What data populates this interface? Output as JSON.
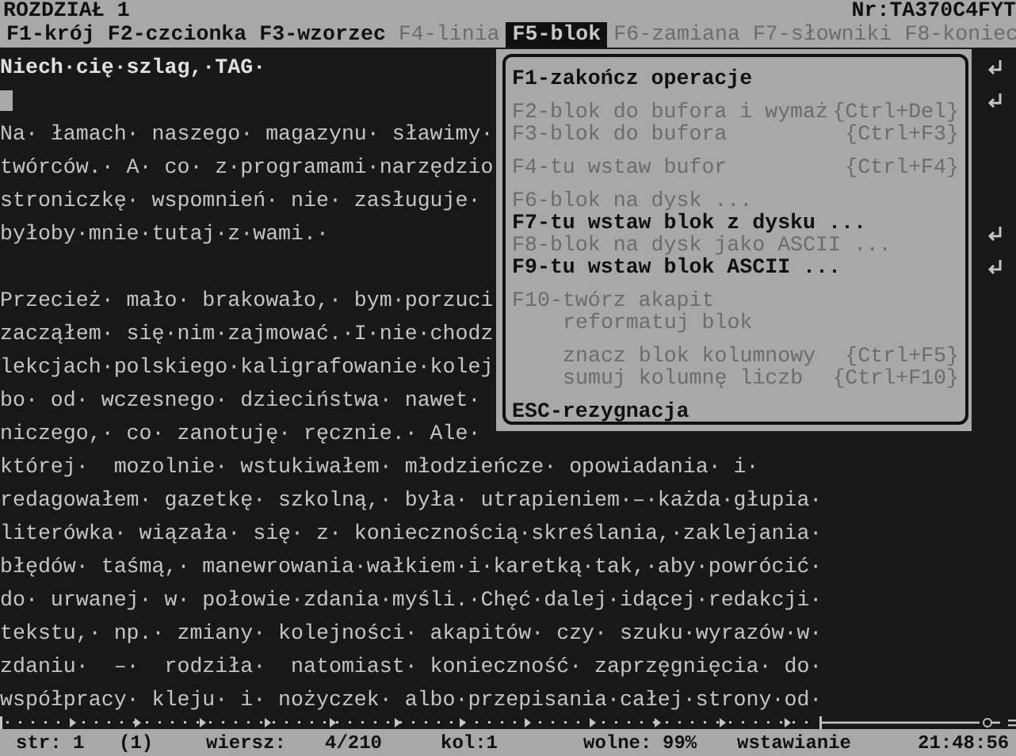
{
  "title_bar": {
    "chapter": "ROZDZIAŁ 1",
    "number": "Nr:TA370C4FYT"
  },
  "menu": [
    {
      "label": "F1-krój",
      "selected": false,
      "disabled": false
    },
    {
      "label": "F2-czcionka",
      "selected": false,
      "disabled": false
    },
    {
      "label": "F3-wzorzec",
      "selected": false,
      "disabled": false
    },
    {
      "label": "F4-linia",
      "selected": false,
      "disabled": true
    },
    {
      "label": "F5-blok",
      "selected": true,
      "disabled": false
    },
    {
      "label": "F6-zamiana",
      "selected": false,
      "disabled": true
    },
    {
      "label": "F7-słowniki",
      "selected": false,
      "disabled": true
    },
    {
      "label": "F8-koniec",
      "selected": false,
      "disabled": true
    }
  ],
  "document": {
    "lines": [
      {
        "kind": "heading",
        "text": "Niech·cię·szlag,·TAG·",
        "paragraph_end": true
      },
      {
        "kind": "cursor",
        "paragraph_end": true
      },
      {
        "kind": "text",
        "text": "Na· łamach· naszego· magazynu· sławimy·",
        "paragraph_end": false
      },
      {
        "kind": "text",
        "text": "twórców.· A· co· z·programami·narzędzio",
        "paragraph_end": false
      },
      {
        "kind": "text",
        "text": "stroniczkę· wspomnień· nie· zasługuje·",
        "paragraph_end": false
      },
      {
        "kind": "text",
        "text": "byłoby·mnie·tutaj·z·wami.·",
        "paragraph_end": true
      },
      {
        "kind": "blank",
        "paragraph_end": true
      },
      {
        "kind": "text",
        "text": "Przecież· mało· brakowało,· bym·porzuci",
        "paragraph_end": false
      },
      {
        "kind": "text",
        "text": "zacząłem· się·nim·zajmować.·I·nie·chodz",
        "paragraph_end": false
      },
      {
        "kind": "text",
        "text": "lekcjach·polskiego·kaligrafowanie·kolej",
        "paragraph_end": false
      },
      {
        "kind": "text",
        "text": "bo· od· wczesnego· dzieciństwa· nawet·",
        "paragraph_end": false
      },
      {
        "kind": "text",
        "text": "niczego,· co· zanotuję· ręcznie.· Ale·",
        "paragraph_end": false
      },
      {
        "kind": "text",
        "text": "której·  mozolnie· wstukiwałem· młodzieńcze· opowiadania· i·",
        "paragraph_end": false
      },
      {
        "kind": "text",
        "text": "redagowałem· gazetkę· szkolną,· była· utrapieniem·–·każda·głupia·",
        "paragraph_end": false
      },
      {
        "kind": "text",
        "text": "literówka· wiązała· się· z· koniecznością·skreślania,·zaklejania·",
        "paragraph_end": false
      },
      {
        "kind": "text",
        "text": "błędów· taśmą,· manewrowania·wałkiem·i·karetką·tak,·aby·powrócić·",
        "paragraph_end": false
      },
      {
        "kind": "text",
        "text": "do· urwanej· w· połowie·zdania·myśli.·Chęć·dalej·idącej·redakcji·",
        "paragraph_end": false
      },
      {
        "kind": "text",
        "text": "tekstu,· np.· zmiany· kolejności· akapitów· czy· szuku·wyrazów·w·",
        "paragraph_end": false
      },
      {
        "kind": "text",
        "text": "zdaniu·  –·  rodziła·  natomiast· konieczność· zaprzęgnięcia· do·",
        "paragraph_end": false
      },
      {
        "kind": "text",
        "text": "współpracy· kleju· i· nożyczek· albo·przepisania·całej·strony·od·",
        "paragraph_end": false
      }
    ]
  },
  "block_menu": {
    "groups": [
      {
        "items": [
          {
            "label": "F1-zakończ operacje",
            "disabled": false,
            "indented": false
          }
        ]
      },
      {
        "items": [
          {
            "label": "F2-blok do bufora i wymaż",
            "shortcut": "{Ctrl+Del}",
            "disabled": true,
            "indented": false
          },
          {
            "label": "F3-blok do bufora",
            "shortcut": "{Ctrl+F3}",
            "disabled": true,
            "indented": false
          }
        ]
      },
      {
        "items": [
          {
            "label": "F4-tu wstaw bufor",
            "shortcut": "{Ctrl+F4}",
            "disabled": true,
            "indented": false
          }
        ]
      },
      {
        "items": [
          {
            "label": "F6-blok na dysk ...",
            "disabled": true,
            "indented": false
          },
          {
            "label": "F7-tu wstaw blok z dysku ...",
            "disabled": false,
            "indented": false
          },
          {
            "label": "F8-blok na dysk jako ASCII ...",
            "disabled": true,
            "indented": false
          },
          {
            "label": "F9-tu wstaw blok ASCII ...",
            "disabled": false,
            "indented": false
          }
        ]
      },
      {
        "items": [
          {
            "label": "F10-twórz akapit",
            "disabled": true,
            "indented": false
          },
          {
            "label": "reformatuj blok",
            "disabled": true,
            "indented": true
          }
        ]
      },
      {
        "items": [
          {
            "label": "znacz blok kolumnowy",
            "shortcut": "{Ctrl+F5}",
            "disabled": true,
            "indented": true
          },
          {
            "label": "sumuj kolumnę liczb",
            "shortcut": "{Ctrl+F10}",
            "disabled": true,
            "indented": true
          }
        ]
      },
      {
        "items": [
          {
            "label": "ESC-rezygnacja",
            "disabled": false,
            "indented": false
          }
        ]
      }
    ]
  },
  "status_bar": [
    "str: 1",
    "(1)",
    "wiersz:",
    "4/210",
    "kol:1",
    "wolne:",
    "99%",
    "wstawianie",
    "21:48:56"
  ]
}
